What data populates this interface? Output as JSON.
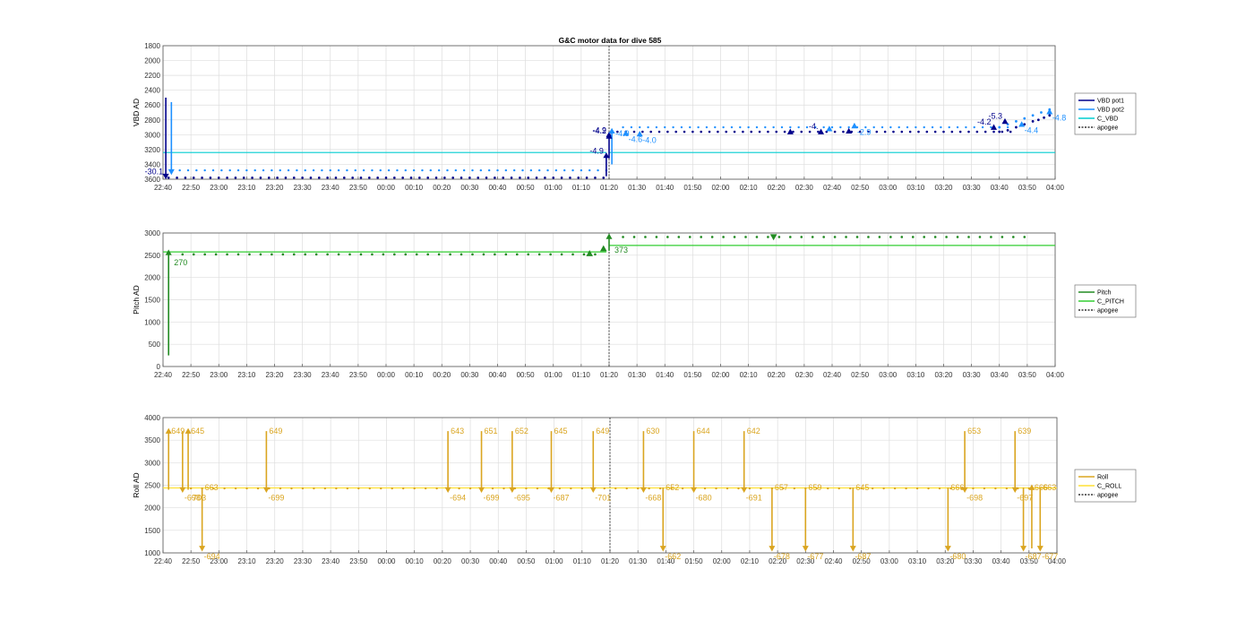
{
  "figure_title": "G&C motor data for dive 585",
  "time_ticks": [
    "22:40",
    "22:50",
    "23:00",
    "23:10",
    "23:20",
    "23:30",
    "23:40",
    "23:50",
    "00:00",
    "00:10",
    "00:20",
    "00:30",
    "00:40",
    "00:50",
    "01:00",
    "01:10",
    "01:20",
    "01:30",
    "01:40",
    "01:50",
    "02:00",
    "02:10",
    "02:20",
    "02:30",
    "02:40",
    "02:50",
    "03:00",
    "03:10",
    "03:20",
    "03:30",
    "03:40",
    "03:50",
    "04:00"
  ],
  "colors": {
    "vbd_pot1": "#00008b",
    "vbd_pot2": "#1e90ff",
    "c_vbd": "#00ced1",
    "pitch": "#228b22",
    "c_pitch": "#32cd32",
    "roll": "#daa520",
    "c_roll": "#ffe135",
    "apogee": "#333333",
    "grid": "#dddddd"
  },
  "chart_data": [
    {
      "type": "scatter",
      "ylabel": "VBD AD",
      "y_reversed": true,
      "ylim": [
        1800,
        3600
      ],
      "yticks": [
        1800,
        2000,
        2200,
        2400,
        2600,
        2800,
        3000,
        3200,
        3400,
        3600
      ],
      "xlim_minutes": [
        0,
        320
      ],
      "apogee_minute": 160,
      "legend": [
        "VBD pot1",
        "VBD pot2",
        "C_VBD",
        "apogee"
      ],
      "legend_position": "right",
      "commanded": [
        {
          "from": 0,
          "to": 159,
          "value": 3240
        },
        {
          "from": 160,
          "to": 320,
          "value": 3240
        }
      ],
      "pot1": {
        "t_start": 2,
        "t_end": 160,
        "step": 3,
        "value": 3580,
        "t_start2": 163,
        "t_end2": 305,
        "step2": 3,
        "value2": 2960
      },
      "pot2": {
        "t_start": 6,
        "t_end": 160,
        "step": 3,
        "value": 3480,
        "t_start2": 165,
        "t_end2": 305,
        "step2": 3,
        "value2": 2900
      },
      "late_pot1": [
        [
          300,
          2960
        ],
        [
          303,
          2940
        ],
        [
          306,
          2900
        ],
        [
          309,
          2860
        ],
        [
          312,
          2820
        ],
        [
          314,
          2800
        ],
        [
          316,
          2770
        ],
        [
          318,
          2740
        ]
      ],
      "late_pot2": [
        [
          300,
          2900
        ],
        [
          303,
          2860
        ],
        [
          306,
          2820
        ],
        [
          309,
          2780
        ],
        [
          312,
          2740
        ],
        [
          315,
          2700
        ],
        [
          318,
          2660
        ]
      ],
      "moves": [
        {
          "t": 1,
          "from": 2500,
          "to": 3560,
          "label": "-30.1",
          "color": "pot1"
        },
        {
          "t": 3,
          "from": 2560,
          "to": 3500,
          "label": "",
          "color": "pot2"
        },
        {
          "t": 159,
          "from": 3560,
          "to": 3280,
          "label": "-4.9",
          "color": "pot1"
        },
        {
          "t": 160,
          "from": 3320,
          "to": 3000,
          "label": "-4.9",
          "color": "pot1"
        },
        {
          "t": 161,
          "from": 3400,
          "to": 2950,
          "label": "-4.9",
          "color": "pot2"
        }
      ],
      "markers": [
        {
          "t": 160,
          "v": 3020,
          "label": "-4.2",
          "color": "pot1"
        },
        {
          "t": 166,
          "v": 2980,
          "label": "-4.6",
          "color": "pot2"
        },
        {
          "t": 171,
          "v": 2990,
          "label": "-4.0",
          "color": "pot2"
        },
        {
          "t": 225,
          "v": 2960,
          "label": "",
          "color": "pot1"
        },
        {
          "t": 236,
          "v": 2960,
          "label": "-4.",
          "color": "pot1"
        },
        {
          "t": 239,
          "v": 2920,
          "label": "",
          "color": "pot2"
        },
        {
          "t": 246,
          "v": 2950,
          "label": "",
          "color": "pot1"
        },
        {
          "t": 248,
          "v": 2880,
          "label": "-2.9",
          "color": "pot2"
        },
        {
          "t": 298,
          "v": 2900,
          "label": "-4.2",
          "color": "pot1"
        },
        {
          "t": 302,
          "v": 2820,
          "label": "-5.3",
          "color": "pot1"
        },
        {
          "t": 308,
          "v": 2860,
          "label": "-4.4",
          "color": "pot2"
        },
        {
          "t": 318,
          "v": 2690,
          "label": "-4.8",
          "color": "pot2"
        }
      ]
    },
    {
      "type": "scatter",
      "ylabel": "Pitch AD",
      "ylim": [
        0,
        3000
      ],
      "yticks": [
        0,
        500,
        1000,
        1500,
        2000,
        2500,
        3000
      ],
      "xlim_minutes": [
        0,
        320
      ],
      "apogee_minute": 160,
      "legend": [
        "Pitch",
        "C_PITCH",
        "apogee"
      ],
      "legend_position": "right",
      "commanded": [
        {
          "from": 0,
          "to": 159,
          "value": 2575
        },
        {
          "from": 160,
          "to": 320,
          "value": 2720
        }
      ],
      "dots": {
        "t_start": 7,
        "t_end": 157,
        "step": 4,
        "value": 2520,
        "t_start2": 165,
        "t_end2": 312,
        "step2": 4,
        "value2": 2910
      },
      "moves": [
        {
          "t": 2,
          "from": 250,
          "to": 2560,
          "label": "270"
        },
        {
          "t": 160,
          "from": 2600,
          "to": 2920,
          "label": "373"
        }
      ],
      "markers": [
        {
          "t": 153,
          "v": 2540,
          "dir": "up"
        },
        {
          "t": 158,
          "v": 2650,
          "dir": "up"
        },
        {
          "t": 219,
          "v": 2910,
          "dir": "down"
        }
      ]
    },
    {
      "type": "scatter",
      "ylabel": "Roll AD",
      "ylim": [
        1000,
        4000
      ],
      "yticks": [
        1000,
        1500,
        2000,
        2500,
        3000,
        3500,
        4000
      ],
      "xlim_minutes": [
        0,
        320
      ],
      "apogee_minute": 160,
      "legend": [
        "Roll",
        "C_ROLL",
        "apogee"
      ],
      "legend_position": "right",
      "commanded_value": 2440,
      "dots": {
        "t_start": 10,
        "t_end": 315,
        "step": 4,
        "value": 2430
      },
      "moves": [
        {
          "t": 2,
          "top": 3700,
          "bottom": 2400,
          "dir": "up",
          "top_label": "649",
          "bottom_label": ""
        },
        {
          "t": 7,
          "top": 3700,
          "bottom": 2400,
          "dir": "down",
          "top_label": "",
          "bottom_label": "-698"
        },
        {
          "t": 9,
          "top": 3700,
          "bottom": 2400,
          "dir": "up",
          "top_label": "645",
          "bottom_label": "-703"
        },
        {
          "t": 14,
          "top": 2450,
          "bottom": 1100,
          "dir": "down",
          "top_label": "663",
          "bottom_label": "-694"
        },
        {
          "t": 37,
          "top": 3700,
          "bottom": 2400,
          "dir": "down",
          "top_label": "649",
          "bottom_label": "-699"
        },
        {
          "t": 102,
          "top": 3700,
          "bottom": 2400,
          "dir": "down",
          "top_label": "643",
          "bottom_label": "-694"
        },
        {
          "t": 114,
          "top": 3700,
          "bottom": 2400,
          "dir": "down",
          "top_label": "651",
          "bottom_label": "-699"
        },
        {
          "t": 125,
          "top": 3700,
          "bottom": 2400,
          "dir": "down",
          "top_label": "652",
          "bottom_label": "-695"
        },
        {
          "t": 139,
          "top": 3700,
          "bottom": 2400,
          "dir": "down",
          "top_label": "645",
          "bottom_label": "-687"
        },
        {
          "t": 154,
          "top": 3700,
          "bottom": 2400,
          "dir": "down",
          "top_label": "649",
          "bottom_label": "-701"
        },
        {
          "t": 172,
          "top": 3700,
          "bottom": 2400,
          "dir": "down",
          "top_label": "630",
          "bottom_label": "-668"
        },
        {
          "t": 179,
          "top": 2450,
          "bottom": 1100,
          "dir": "down",
          "top_label": "652",
          "bottom_label": "-662"
        },
        {
          "t": 190,
          "top": 3700,
          "bottom": 2400,
          "dir": "down",
          "top_label": "644",
          "bottom_label": "-680"
        },
        {
          "t": 208,
          "top": 3700,
          "bottom": 2400,
          "dir": "down",
          "top_label": "642",
          "bottom_label": "-691"
        },
        {
          "t": 218,
          "top": 2450,
          "bottom": 1100,
          "dir": "down",
          "top_label": "657",
          "bottom_label": "-678"
        },
        {
          "t": 230,
          "top": 2450,
          "bottom": 1100,
          "dir": "down",
          "top_label": "659",
          "bottom_label": "-677"
        },
        {
          "t": 247,
          "top": 2450,
          "bottom": 1100,
          "dir": "down",
          "top_label": "645",
          "bottom_label": "-687"
        },
        {
          "t": 281,
          "top": 2450,
          "bottom": 1100,
          "dir": "down",
          "top_label": "666",
          "bottom_label": "-680"
        },
        {
          "t": 287,
          "top": 3700,
          "bottom": 2400,
          "dir": "down",
          "top_label": "653",
          "bottom_label": "-698"
        },
        {
          "t": 305,
          "top": 3700,
          "bottom": 2400,
          "dir": "down",
          "top_label": "639",
          "bottom_label": "-697"
        },
        {
          "t": 308,
          "top": 2450,
          "bottom": 1100,
          "dir": "down",
          "top_label": "",
          "bottom_label": "-687"
        },
        {
          "t": 311,
          "top": 2450,
          "bottom": 1100,
          "dir": "up",
          "top_label": "666",
          "bottom_label": ""
        },
        {
          "t": 314,
          "top": 2450,
          "bottom": 1100,
          "dir": "down",
          "top_label": "663",
          "bottom_label": "-677"
        }
      ]
    }
  ]
}
